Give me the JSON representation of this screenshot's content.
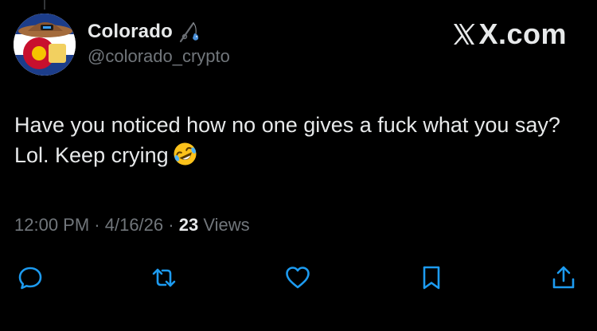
{
  "tweet": {
    "author": {
      "display_name": "Colorado",
      "handle": "@colorado_crypto",
      "avatar_icon": "colorado-flag-avatar",
      "name_emoji_icon": "fishing-pole-icon"
    },
    "brand": {
      "text": "X.com",
      "logo_icon": "x-logo-icon"
    },
    "text": "Have you noticed how no one gives a fuck what you say? Lol. Keep crying",
    "text_emoji": "rolling-on-floor-laughing-emoji",
    "meta": {
      "time": "12:00 PM",
      "separator": " · ",
      "date": "4/16/26",
      "views_count": "23",
      "views_label": "Views"
    },
    "actions": [
      {
        "name": "reply",
        "icon": "reply-icon"
      },
      {
        "name": "retweet",
        "icon": "retweet-icon"
      },
      {
        "name": "like",
        "icon": "heart-icon"
      },
      {
        "name": "bookmark",
        "icon": "bookmark-icon"
      },
      {
        "name": "share",
        "icon": "share-icon"
      }
    ]
  },
  "colors": {
    "background": "#000000",
    "primary_text": "#e7e9ea",
    "secondary_text": "#71767b",
    "action_icon": "#1d9bf0"
  }
}
